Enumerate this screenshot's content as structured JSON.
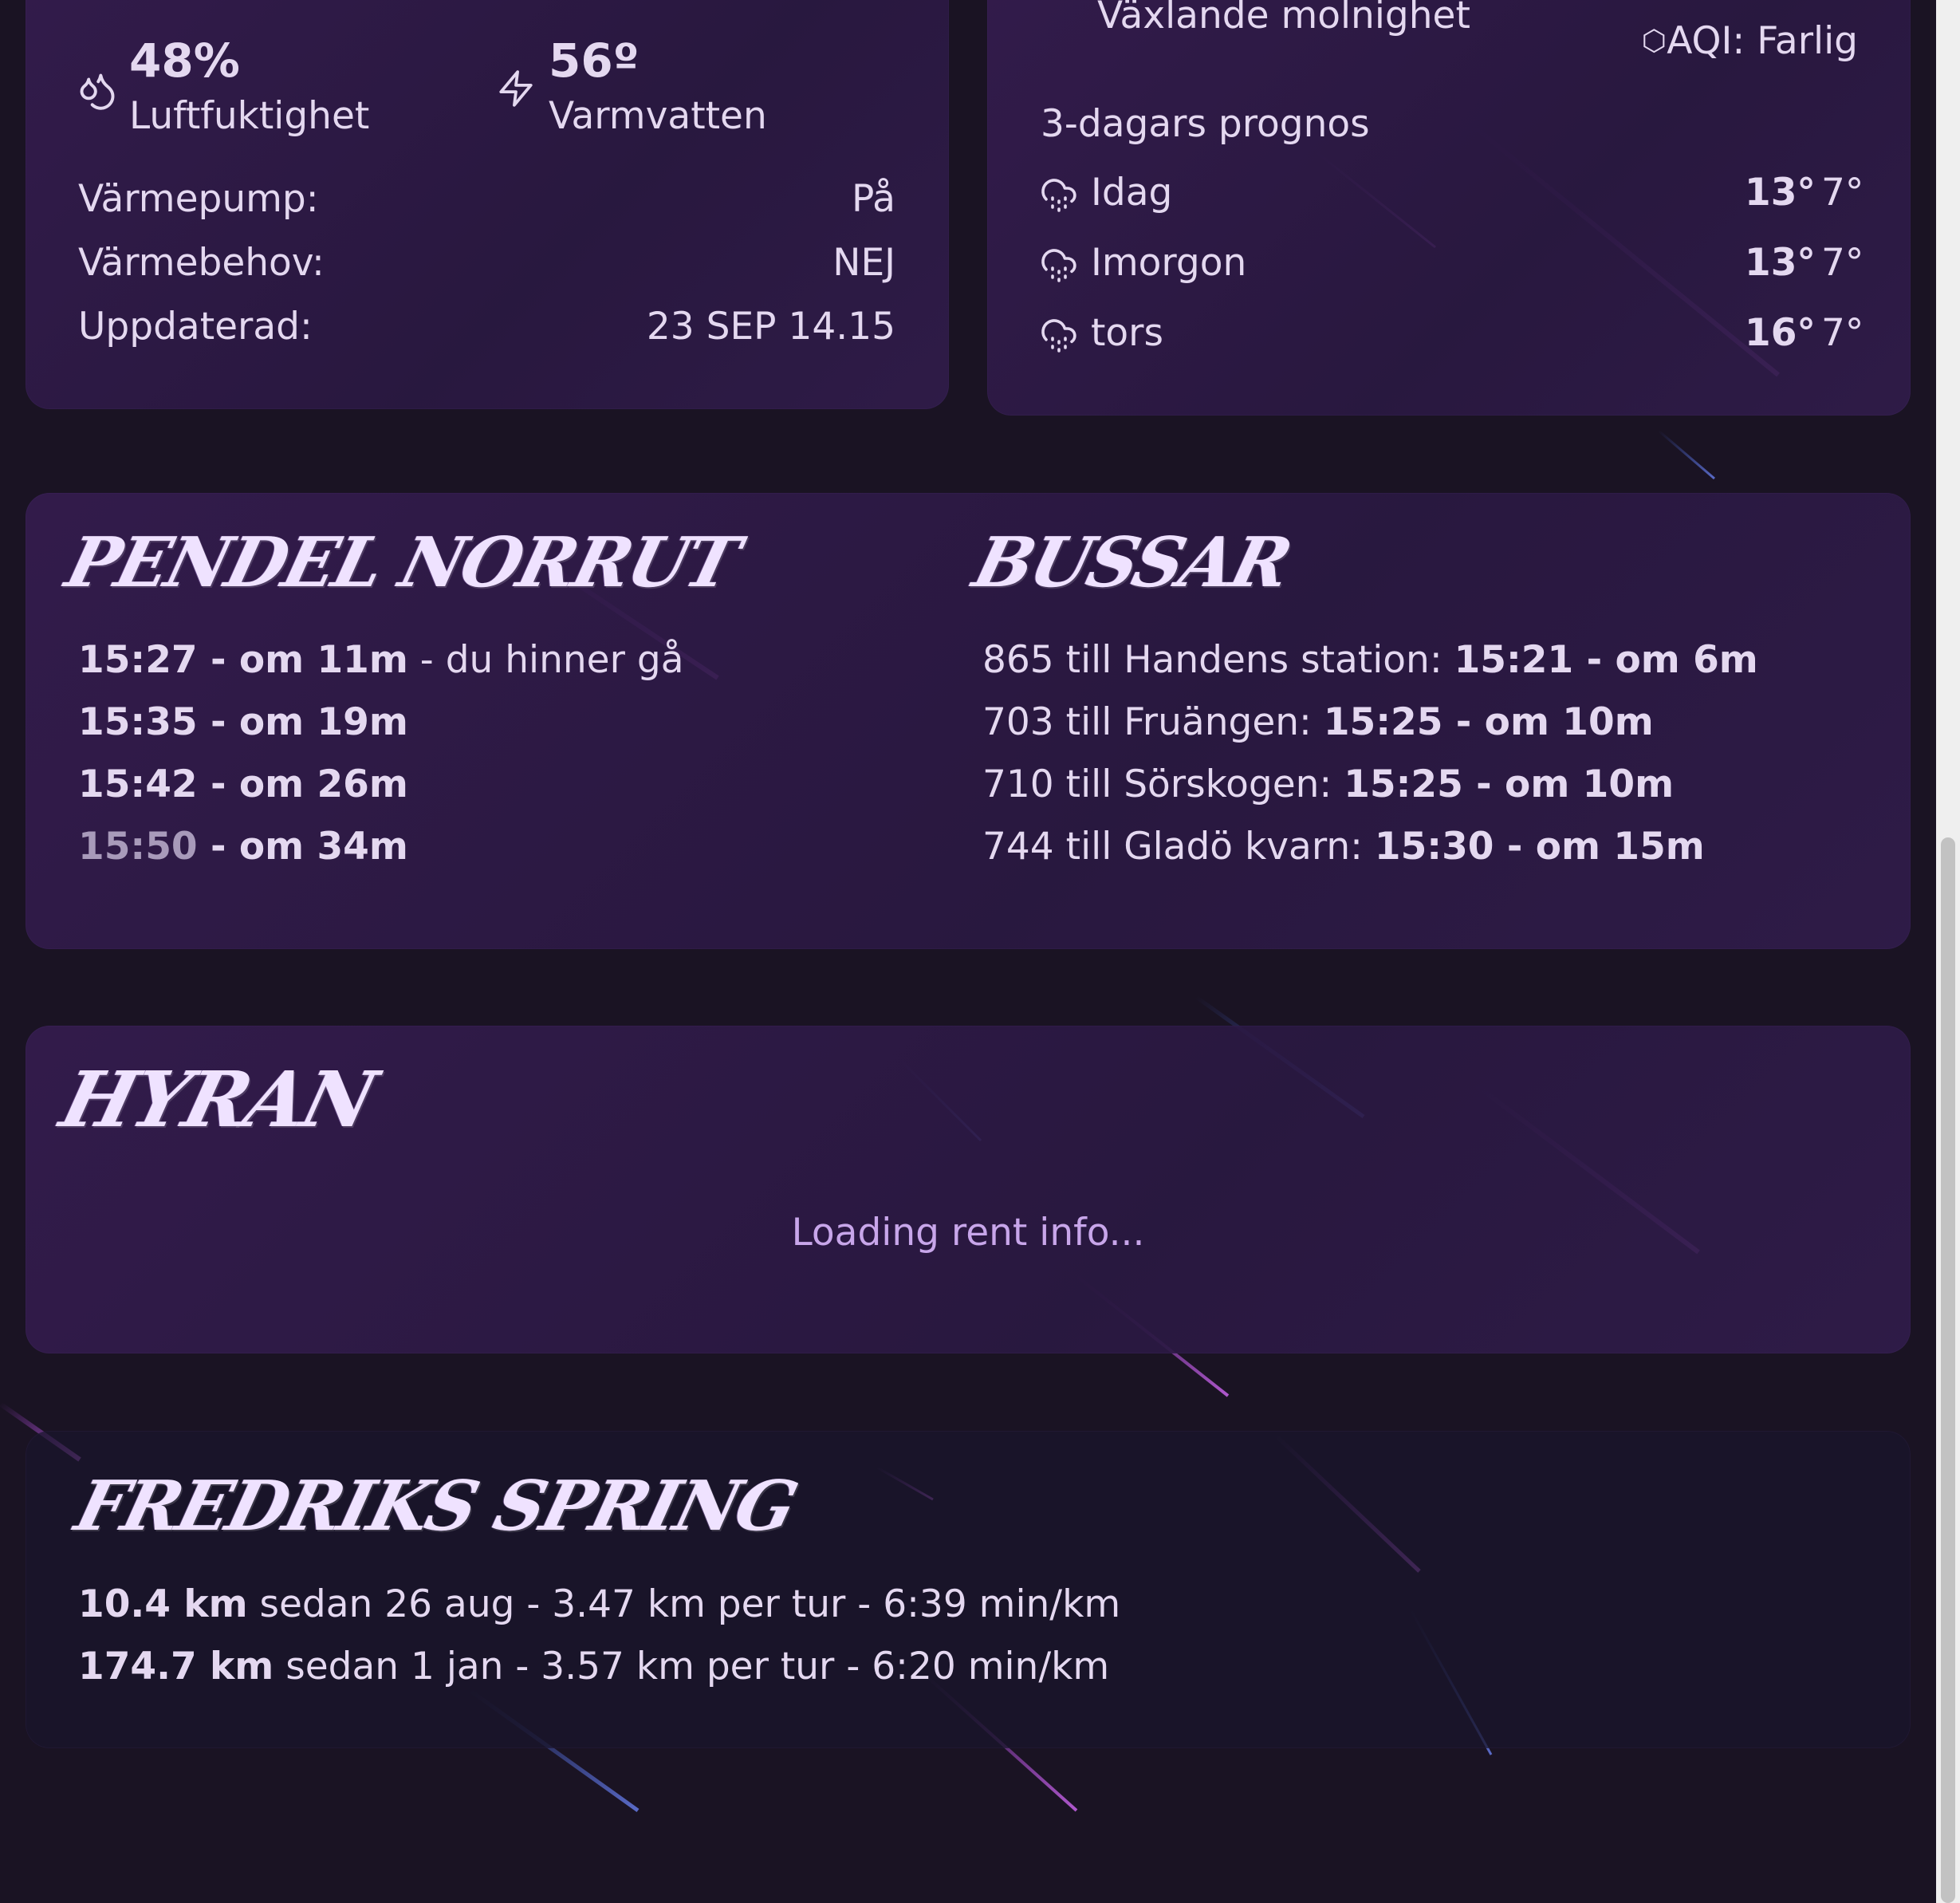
{
  "home": {
    "humidity_value": "48%",
    "humidity_label": "Luftfuktighet",
    "hotwater_value": "56º",
    "hotwater_label": "Varmvatten",
    "rows": [
      {
        "label": "Värmepump:",
        "value": "På"
      },
      {
        "label": "Värmebehov:",
        "value": "NEJ"
      },
      {
        "label": "Uppdaterad:",
        "value": "23 SEP 14.15"
      }
    ]
  },
  "weather": {
    "condition": "Växlande molnighet",
    "aqi": "AQI: Farlig",
    "forecast_title": "3-dagars prognos",
    "days": [
      {
        "day": "Idag",
        "high": "13°",
        "low": "7°",
        "icon": "cloud-rain-icon"
      },
      {
        "day": "Imorgon",
        "high": "13°",
        "low": "7°",
        "icon": "cloud-rain-icon"
      },
      {
        "day": "tors",
        "high": "16°",
        "low": "7°",
        "icon": "cloud-rain-icon"
      }
    ]
  },
  "pendel": {
    "title": "Pendel norrut",
    "departures": [
      {
        "time": "15:27",
        "rel": " - om 11m",
        "note": " - du hinner gå"
      },
      {
        "time": "15:35",
        "rel": " - om 19m",
        "note": ""
      },
      {
        "time": "15:42",
        "rel": " - om 26m",
        "note": ""
      },
      {
        "time": "15:50",
        "rel": " - om 34m",
        "note": ""
      }
    ]
  },
  "bussar": {
    "title": "Bussar",
    "departures": [
      {
        "route": "865 till Handens station: ",
        "time": "15:21 - om 6m"
      },
      {
        "route": "703 till Fruängen: ",
        "time": "15:25 - om 10m"
      },
      {
        "route": "710 till Sörskogen: ",
        "time": "15:25 - om 10m"
      },
      {
        "route": "744 till Gladö kvarn: ",
        "time": "15:30 - om 15m"
      }
    ]
  },
  "hyran": {
    "title": "Hyran",
    "loading": "Loading rent info..."
  },
  "running": {
    "title": "Fredriks spring",
    "rows": [
      {
        "distance": "10.4 km",
        "text": " sedan 26 aug - 3.47 km per tur - 6:39 min/km"
      },
      {
        "distance": "174.7 km",
        "text": " sedan 1 jan - 3.57 km per tur - 6:20 min/km"
      }
    ]
  },
  "colors": {
    "background": "#1a1323",
    "card": "#2f1c48",
    "accent": "#c8a6ea",
    "streak": "#a040d0"
  }
}
